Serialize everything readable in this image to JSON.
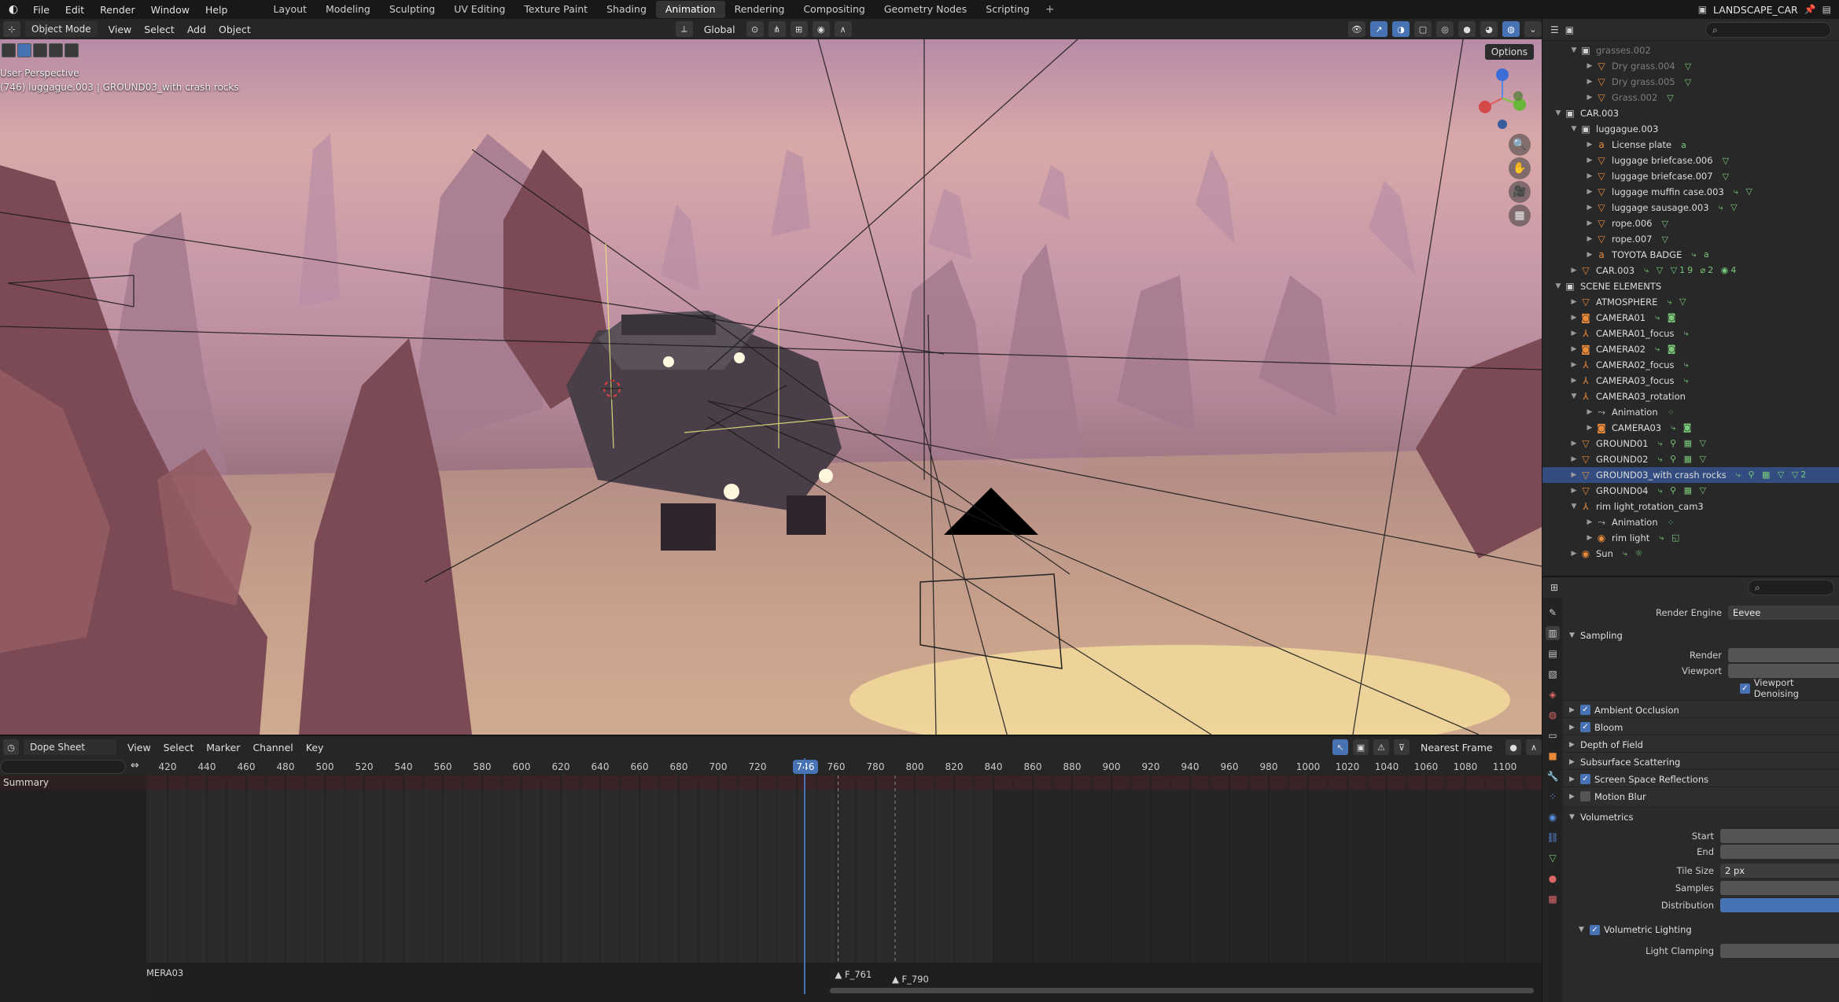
{
  "menu": [
    "File",
    "Edit",
    "Render",
    "Window",
    "Help"
  ],
  "workspace_tabs": [
    {
      "label": "Layout",
      "active": false
    },
    {
      "label": "Modeling",
      "active": false
    },
    {
      "label": "Sculpting",
      "active": false
    },
    {
      "label": "UV Editing",
      "active": false
    },
    {
      "label": "Texture Paint",
      "active": false
    },
    {
      "label": "Shading",
      "active": false
    },
    {
      "label": "Animation",
      "active": true
    },
    {
      "label": "Rendering",
      "active": false
    },
    {
      "label": "Compositing",
      "active": false
    },
    {
      "label": "Geometry Nodes",
      "active": false
    },
    {
      "label": "Scripting",
      "active": false
    }
  ],
  "scene_name": "LANDSCAPE_CAR",
  "viewport": {
    "mode": "Object Mode",
    "menus": [
      "View",
      "Select",
      "Add",
      "Object"
    ],
    "orientation": "Global",
    "options_label": "Options",
    "perspective_label": "User Perspective",
    "context_label": "(746) luggague.003 | GROUND03_with crash rocks"
  },
  "outliner": {
    "rows": [
      {
        "label": "grasses.002",
        "indent": 1,
        "expanded": true,
        "icon": "collection-icon",
        "dim": true,
        "extras": ""
      },
      {
        "label": "Dry grass.004",
        "indent": 2,
        "expanded": false,
        "icon": "mesh-icon",
        "dim": true,
        "extras": "▽"
      },
      {
        "label": "Dry grass.005",
        "indent": 2,
        "expanded": false,
        "icon": "mesh-icon",
        "dim": true,
        "extras": "▽"
      },
      {
        "label": "Grass.002",
        "indent": 2,
        "expanded": false,
        "icon": "mesh-icon",
        "dim": true,
        "extras": "▽"
      },
      {
        "label": "CAR.003",
        "indent": 0,
        "expanded": true,
        "icon": "collection-icon",
        "dim": false,
        "extras": ""
      },
      {
        "label": "luggague.003",
        "indent": 1,
        "expanded": true,
        "icon": "collection-icon",
        "dim": false,
        "extras": ""
      },
      {
        "label": "License plate",
        "indent": 2,
        "expanded": false,
        "icon": "text-icon",
        "dim": false,
        "extras": "a"
      },
      {
        "label": "luggage briefcase.006",
        "indent": 2,
        "expanded": false,
        "icon": "mesh-icon",
        "dim": false,
        "extras": "▽"
      },
      {
        "label": "luggage briefcase.007",
        "indent": 2,
        "expanded": false,
        "icon": "mesh-icon",
        "dim": false,
        "extras": "▽"
      },
      {
        "label": "luggage muffin case.003",
        "indent": 2,
        "expanded": false,
        "icon": "mesh-icon",
        "dim": false,
        "extras": "⤷ ▽"
      },
      {
        "label": "luggage sausage.003",
        "indent": 2,
        "expanded": false,
        "icon": "mesh-icon",
        "dim": false,
        "extras": "⤷ ▽"
      },
      {
        "label": "rope.006",
        "indent": 2,
        "expanded": false,
        "icon": "mesh-icon",
        "dim": false,
        "extras": "▽"
      },
      {
        "label": "rope.007",
        "indent": 2,
        "expanded": false,
        "icon": "mesh-icon",
        "dim": false,
        "extras": "▽"
      },
      {
        "label": "TOYOTA BADGE",
        "indent": 2,
        "expanded": false,
        "icon": "text-icon",
        "dim": false,
        "extras": "⤷ a"
      },
      {
        "label": "CAR.003",
        "indent": 1,
        "expanded": false,
        "icon": "mesh-icon",
        "dim": false,
        "extras": "⤷ ▽ ▽19 ⌀2 ◉4"
      },
      {
        "label": "SCENE ELEMENTS",
        "indent": 0,
        "expanded": true,
        "icon": "collection-icon",
        "dim": false,
        "extras": ""
      },
      {
        "label": "ATMOSPHERE",
        "indent": 1,
        "expanded": false,
        "icon": "mesh-icon",
        "dim": false,
        "extras": "⤷ ▽"
      },
      {
        "label": "CAMERA01",
        "indent": 1,
        "expanded": false,
        "icon": "camera-icon",
        "dim": false,
        "extras": "⤷ ◙"
      },
      {
        "label": "CAMERA01_focus",
        "indent": 1,
        "expanded": false,
        "icon": "empty-icon",
        "dim": false,
        "extras": "⤷"
      },
      {
        "label": "CAMERA02",
        "indent": 1,
        "expanded": false,
        "icon": "camera-icon",
        "dim": false,
        "extras": "⤷ ◙"
      },
      {
        "label": "CAMERA02_focus",
        "indent": 1,
        "expanded": false,
        "icon": "empty-icon",
        "dim": false,
        "extras": "⤷"
      },
      {
        "label": "CAMERA03_focus",
        "indent": 1,
        "expanded": false,
        "icon": "empty-icon",
        "dim": false,
        "extras": "⤷"
      },
      {
        "label": "CAMERA03_rotation",
        "indent": 1,
        "expanded": true,
        "icon": "empty-icon",
        "dim": false,
        "extras": ""
      },
      {
        "label": "Animation",
        "indent": 2,
        "expanded": false,
        "icon": "action-icon",
        "dim": false,
        "extras": "⁘"
      },
      {
        "label": "CAMERA03",
        "indent": 2,
        "expanded": false,
        "icon": "camera-icon",
        "dim": false,
        "extras": "⤷ ◙"
      },
      {
        "label": "GROUND01",
        "indent": 1,
        "expanded": false,
        "icon": "mesh-icon",
        "dim": false,
        "extras": "⤷ ⚲ ▦ ▽"
      },
      {
        "label": "GROUND02",
        "indent": 1,
        "expanded": false,
        "icon": "mesh-icon",
        "dim": false,
        "extras": "⤷ ⚲ ▦ ▽"
      },
      {
        "label": "GROUND03_with crash rocks",
        "indent": 1,
        "expanded": false,
        "icon": "mesh-icon",
        "dim": false,
        "selected": true,
        "extras": "⤷ ⚲ ▦ ▽ ▽2"
      },
      {
        "label": "GROUND04",
        "indent": 1,
        "expanded": false,
        "icon": "mesh-icon",
        "dim": false,
        "extras": "⤷ ⚲ ▦ ▽"
      },
      {
        "label": "rim light_rotation_cam3",
        "indent": 1,
        "expanded": true,
        "icon": "empty-icon",
        "dim": false,
        "extras": ""
      },
      {
        "label": "Animation",
        "indent": 2,
        "expanded": false,
        "icon": "action-icon",
        "dim": false,
        "extras": "⁘"
      },
      {
        "label": "rim light",
        "indent": 2,
        "expanded": false,
        "icon": "light-icon",
        "dim": false,
        "extras": "⤷ ◱"
      },
      {
        "label": "Sun",
        "indent": 1,
        "expanded": false,
        "icon": "light-icon",
        "dim": false,
        "extras": "⤷ ☼"
      }
    ]
  },
  "properties": {
    "render_engine_label": "Render Engine",
    "render_engine_value": "Eevee",
    "sampling": "Sampling",
    "render_label": "Render",
    "viewport_label": "Viewport",
    "viewport_denoising": "Viewport Denoising",
    "panels": [
      {
        "label": "Ambient Occlusion",
        "checkbox": true
      },
      {
        "label": "Bloom",
        "checkbox": true
      },
      {
        "label": "Depth of Field",
        "checkbox": null
      },
      {
        "label": "Subsurface Scattering",
        "checkbox": null
      },
      {
        "label": "Screen Space Reflections",
        "checkbox": true
      },
      {
        "label": "Motion Blur",
        "checkbox": false
      }
    ],
    "volumetrics": "Volumetrics",
    "start_label": "Start",
    "end_label": "End",
    "tile_size_label": "Tile Size",
    "tile_size_value": "2 px",
    "samples_label": "Samples",
    "distribution_label": "Distribution",
    "volumetric_lighting": "Volumetric Lighting",
    "light_clamping": "Light Clamping"
  },
  "dopesheet": {
    "mode": "Dope Sheet",
    "menus": [
      "View",
      "Select",
      "Marker",
      "Channel",
      "Key"
    ],
    "snapping": "Nearest Frame",
    "summary": "Summary",
    "ruler_numbers": [
      420,
      440,
      460,
      480,
      500,
      520,
      540,
      560,
      580,
      600,
      620,
      640,
      660,
      680,
      700,
      720,
      740,
      760,
      780,
      800,
      820,
      840,
      860,
      880,
      900,
      920,
      940,
      960,
      980,
      1000,
      1020,
      1040,
      1060,
      1080,
      1100
    ],
    "current_frame": "746",
    "markers": [
      {
        "label": "MERA03",
        "frame": 0
      },
      {
        "label": "F_761",
        "frame": 761
      },
      {
        "label": "F_790",
        "frame": 790
      }
    ]
  }
}
